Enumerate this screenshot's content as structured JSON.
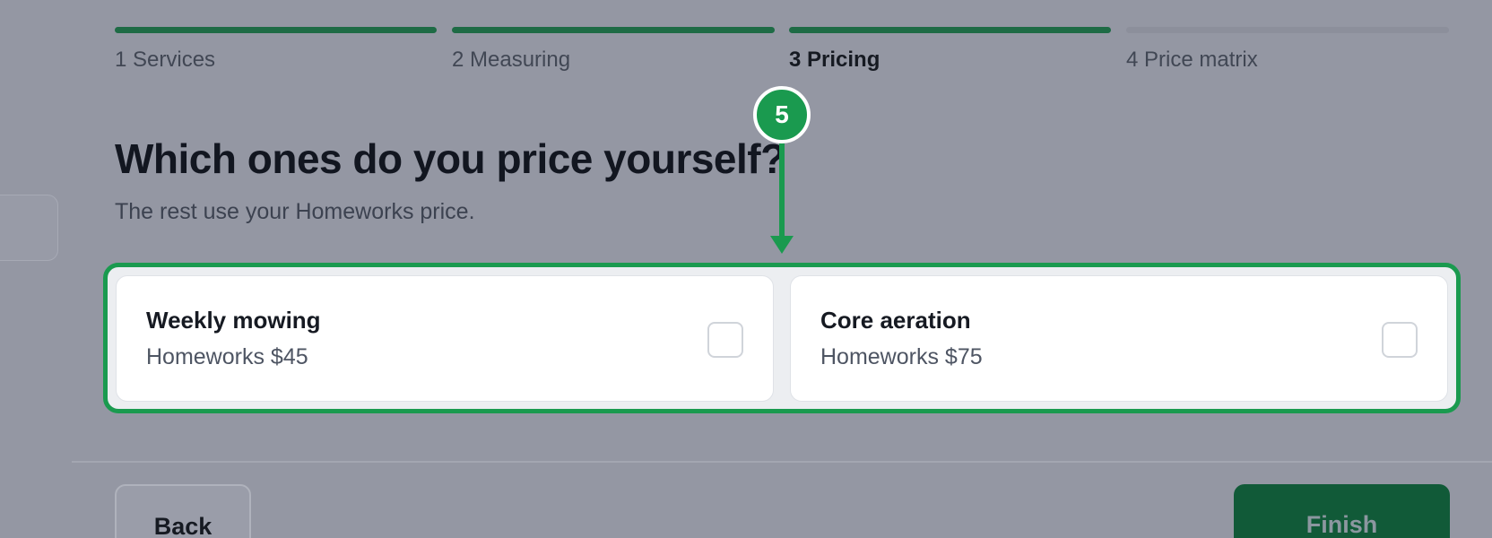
{
  "stepper": {
    "steps": [
      {
        "label": "1 Services",
        "state": "complete"
      },
      {
        "label": "2 Measuring",
        "state": "complete"
      },
      {
        "label": "3 Pricing",
        "state": "current"
      },
      {
        "label": "4 Price matrix",
        "state": "upcoming"
      }
    ]
  },
  "main": {
    "title": "Which ones do you price yourself?",
    "subtitle": "The rest use your Homeworks price."
  },
  "services": [
    {
      "name": "Weekly mowing",
      "price": "Homeworks $45",
      "checked": false
    },
    {
      "name": "Core aeration",
      "price": "Homeworks $75",
      "checked": false
    }
  ],
  "callout": {
    "number": "5"
  },
  "footer": {
    "back_label": "Back",
    "finish_label": "Finish"
  },
  "colors": {
    "overlay": "#9497a3",
    "accent_green": "#1a9a4f",
    "step_complete": "#1e6b45",
    "step_upcoming": "#8c8f9b",
    "finish_button": "#115a38"
  }
}
